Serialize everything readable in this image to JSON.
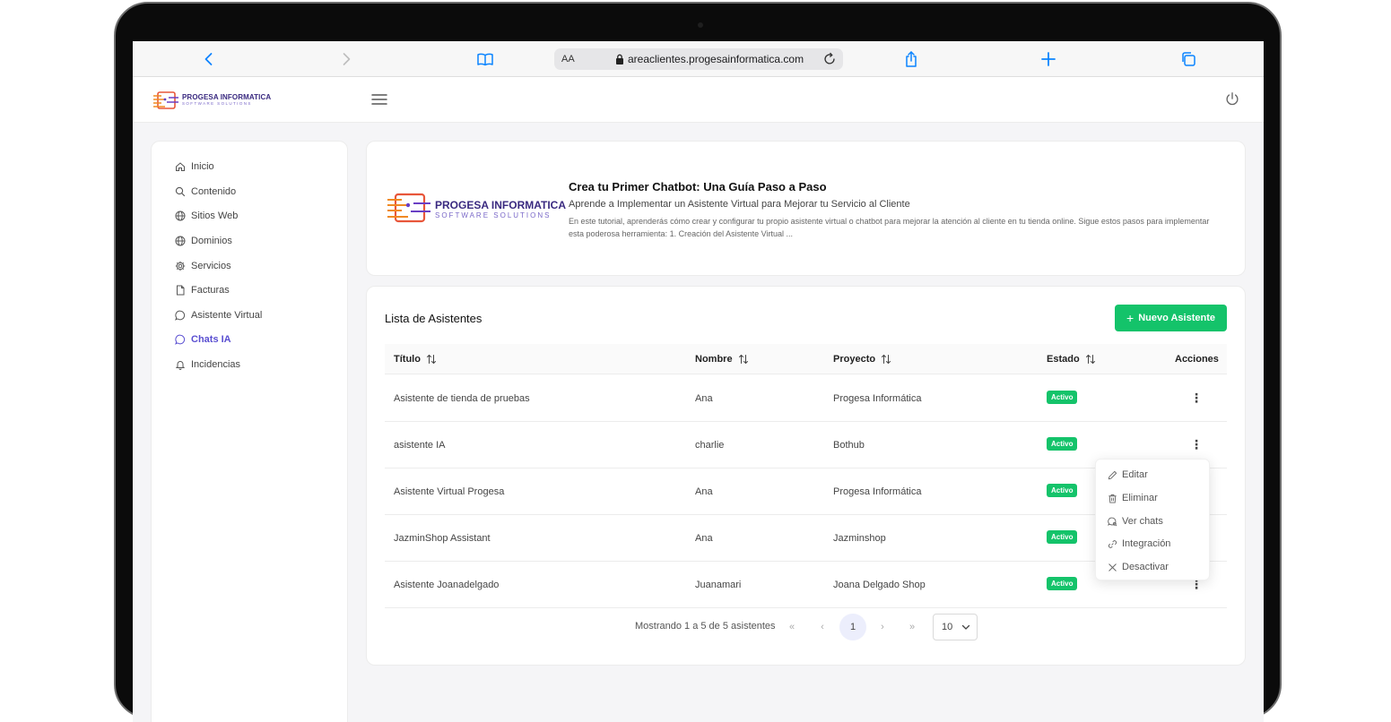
{
  "browser": {
    "text_size_label": "AA",
    "url": "areaclientes.progesainformatica.com"
  },
  "brand": {
    "name": "PROGESA INFORMATICA",
    "tagline": "SOFTWARE SOLUTIONS"
  },
  "sidebar": {
    "items": [
      {
        "label": "Inicio",
        "icon": "home-icon"
      },
      {
        "label": "Contenido",
        "icon": "search-icon"
      },
      {
        "label": "Sitios Web",
        "icon": "globe-icon"
      },
      {
        "label": "Dominios",
        "icon": "globe-icon"
      },
      {
        "label": "Servicios",
        "icon": "gear-icon"
      },
      {
        "label": "Facturas",
        "icon": "file-icon"
      },
      {
        "label": "Asistente Virtual",
        "icon": "chat-icon"
      },
      {
        "label": "Chats IA",
        "icon": "chat-icon",
        "active": true
      },
      {
        "label": "Incidencias",
        "icon": "bell-icon"
      }
    ]
  },
  "banner": {
    "title": "Crea tu Primer Chatbot: Una Guía Paso a Paso",
    "subtitle": "Aprende a Implementar un Asistente Virtual para Mejorar tu Servicio al Cliente",
    "description": "En este tutorial, aprenderás cómo crear y configurar tu propio asistente virtual o chatbot para mejorar la atención al cliente en tu tienda online. Sigue estos pasos para implementar esta poderosa herramienta: 1. Creación del Asistente Virtual ..."
  },
  "list": {
    "title": "Lista de Asistentes",
    "new_button_label": "Nuevo Asistente",
    "columns": {
      "titulo": "Título",
      "nombre": "Nombre",
      "proyecto": "Proyecto",
      "estado": "Estado",
      "acciones": "Acciones"
    },
    "rows": [
      {
        "titulo": "Asistente de tienda de pruebas",
        "nombre": "Ana",
        "proyecto": "Progesa Informática",
        "estado": "Activo"
      },
      {
        "titulo": "asistente IA",
        "nombre": "charlie",
        "proyecto": "Bothub",
        "estado": "Activo"
      },
      {
        "titulo": "Asistente Virtual Progesa",
        "nombre": "Ana",
        "proyecto": "Progesa Informática",
        "estado": "Activo"
      },
      {
        "titulo": "JazminShop Assistant",
        "nombre": "Ana",
        "proyecto": "Jazminshop",
        "estado": "Activo"
      },
      {
        "titulo": "Asistente Joanadelgado",
        "nombre": "Juanamari",
        "proyecto": "Joana Delgado Shop",
        "estado": "Activo"
      }
    ],
    "kebab_symbol": "⋮"
  },
  "pagination": {
    "info": "Mostrando 1 a 5 de 5 asistentes",
    "first": "«",
    "prev": "‹",
    "current_page": "1",
    "next": "›",
    "last": "»",
    "per_page": "10"
  },
  "action_menu": {
    "items": [
      {
        "label": "Editar",
        "icon": "pencil-icon"
      },
      {
        "label": "Eliminar",
        "icon": "trash-icon"
      },
      {
        "label": "Ver chats",
        "icon": "chat-search-icon"
      },
      {
        "label": "Integración",
        "icon": "link-icon"
      },
      {
        "label": "Desactivar",
        "icon": "close-icon"
      }
    ]
  },
  "colors": {
    "accent": "#5a4fd1",
    "success": "#14c36a",
    "browser_blue": "#0a84ff"
  }
}
